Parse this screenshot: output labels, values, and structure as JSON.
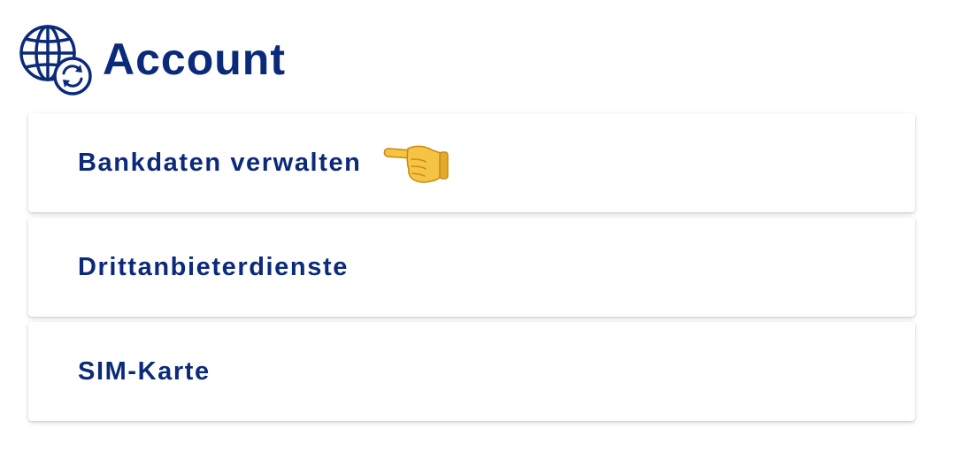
{
  "header": {
    "title": "Account",
    "icon": "globe-sync-icon"
  },
  "menu": {
    "items": [
      {
        "label": "Bankdaten verwalten",
        "pointer_icon": "pointing-left-hand-icon"
      },
      {
        "label": "Drittanbieterdienste"
      },
      {
        "label": "SIM-Karte"
      }
    ]
  },
  "colors": {
    "primary": "#0b2a7a",
    "hand_fill": "#f6c445",
    "hand_outline": "#c98a10",
    "card_bg": "#ffffff"
  }
}
